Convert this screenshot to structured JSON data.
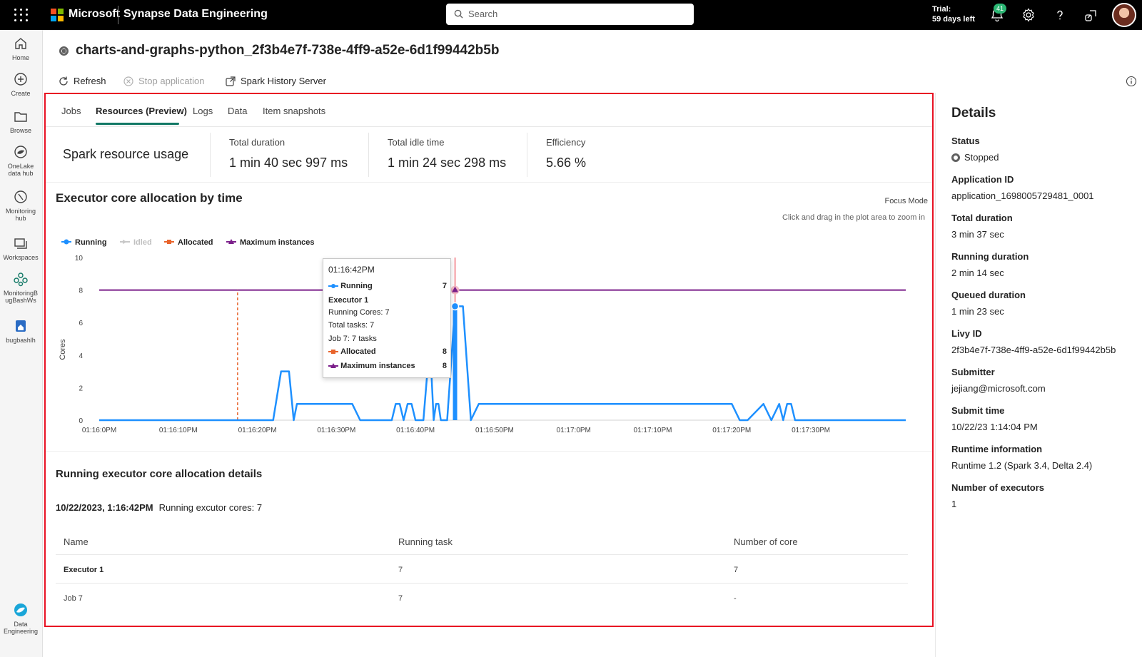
{
  "topbar": {
    "brand": "Microsoft",
    "app_name": "Synapse Data Engineering",
    "search_placeholder": "Search",
    "trial_line1": "Trial:",
    "trial_line2": "59 days left",
    "notification_count": "41"
  },
  "rail": {
    "items": [
      {
        "label": "Home",
        "icon": "home-icon"
      },
      {
        "label": "Create",
        "icon": "plus-circle-icon"
      },
      {
        "label": "Browse",
        "icon": "folder-icon"
      },
      {
        "label_line1": "OneLake",
        "label_line2": "data hub",
        "icon": "onelake-icon"
      },
      {
        "label_line1": "Monitoring",
        "label_line2": "hub",
        "icon": "monitor-icon"
      },
      {
        "label": "Workspaces",
        "icon": "workspaces-icon"
      },
      {
        "label_line1": "MonitoringB",
        "label_line2": "ugBashWs",
        "icon": "workspace-people-icon"
      },
      {
        "label": "bugbashlh",
        "icon": "lakehouse-icon"
      },
      {
        "label_line1": "Data",
        "label_line2": "Engineering",
        "icon": "data-engineering-icon"
      }
    ]
  },
  "header": {
    "title": "charts-and-graphs-python_2f3b4e7f-738e-4ff9-a52e-6d1f99442b5b",
    "refresh": "Refresh",
    "stop": "Stop application",
    "history": "Spark History Server"
  },
  "tabs": [
    "Jobs",
    "Resources (Preview)",
    "Logs",
    "Data",
    "Item snapshots"
  ],
  "usage": {
    "title": "Spark resource usage",
    "total_duration_label": "Total duration",
    "total_duration": "1 min 40 sec 997 ms",
    "idle_label": "Total idle time",
    "idle": "1 min 24 sec 298 ms",
    "efficiency_label": "Efficiency",
    "efficiency": "5.66 %"
  },
  "chart": {
    "title": "Executor core allocation by time",
    "focus_mode": "Focus Mode",
    "zoom_hint": "Click and drag in the plot area to zoom in"
  },
  "chart_data": {
    "type": "line",
    "ylabel": "Cores",
    "ylim": [
      0,
      10
    ],
    "yticks": [
      "0",
      "2",
      "4",
      "6",
      "8",
      "10"
    ],
    "xticks": [
      "01:16:0PM",
      "01:16:10PM",
      "01:16:20PM",
      "01:16:30PM",
      "01:16:40PM",
      "01:16:50PM",
      "01:17:0PM",
      "01:17:10PM",
      "01:17:20PM",
      "01:17:30PM"
    ],
    "legend": [
      "Running",
      "Idled",
      "Allocated",
      "Maximum instances"
    ],
    "colors": {
      "running": "#1e90ff",
      "idled": "#c8c8c8",
      "allocated": "#e8642c",
      "max": "#7b1f8a",
      "cursor": "#e81123"
    },
    "series": [
      {
        "name": "Running",
        "x": [
          0,
          22,
          23,
          24,
          24.6,
          25,
          25.6,
          32,
          33,
          37,
          37.5,
          38,
          38.5,
          39,
          39.5,
          40,
          40.5,
          41,
          41.5,
          42,
          42.3,
          42.6,
          42.9,
          43.2,
          43.6,
          44,
          45,
          46,
          47,
          48,
          80,
          81,
          82,
          84,
          85,
          86,
          86.5,
          87,
          87.5,
          88,
          102
        ],
        "y": [
          0,
          0,
          3,
          3,
          0,
          1,
          1,
          1,
          0,
          0,
          1,
          1,
          0,
          1,
          1,
          0,
          0,
          0,
          3,
          3,
          0,
          1,
          1,
          0,
          0,
          0,
          7,
          7,
          0,
          1,
          1,
          0,
          0,
          1,
          0,
          1,
          0,
          1,
          1,
          0,
          0
        ]
      },
      {
        "name": "Maximum instances",
        "x": [
          0,
          102
        ],
        "y": [
          8,
          8
        ]
      },
      {
        "name": "Allocated",
        "x": [
          17.5,
          17.5
        ],
        "y": [
          0,
          8
        ]
      }
    ]
  },
  "tooltip": {
    "time": "01:16:42PM",
    "running_label": "Running",
    "running_value": "7",
    "executor": "Executor 1",
    "running_cores": "Running Cores: 7",
    "total_tasks": "Total tasks: 7",
    "job": "Job 7: 7 tasks",
    "allocated_label": "Allocated",
    "allocated_value": "8",
    "max_label": "Maximum instances",
    "max_value": "8"
  },
  "details_section": {
    "title": "Running executor core allocation details",
    "timestamp": "10/22/2023, 1:16:42PM",
    "cores_text": "Running excutor cores: 7",
    "columns": [
      "Name",
      "Running task",
      "Number of core"
    ],
    "rows": [
      [
        "Executor 1",
        "7",
        "7"
      ],
      [
        "Job 7",
        "7",
        "-"
      ]
    ]
  },
  "details_pane": {
    "title": "Details",
    "fields": [
      {
        "label": "Status",
        "value": "Stopped"
      },
      {
        "label": "Application ID",
        "value": "application_1698005729481_0001"
      },
      {
        "label": "Total duration",
        "value": "3 min 37 sec"
      },
      {
        "label": "Running duration",
        "value": "2 min 14 sec"
      },
      {
        "label": "Queued duration",
        "value": "1 min 23 sec"
      },
      {
        "label": "Livy ID",
        "value": "2f3b4e7f-738e-4ff9-a52e-6d1f99442b5b"
      },
      {
        "label": "Submitter",
        "value": "jejiang@microsoft.com"
      },
      {
        "label": "Submit time",
        "value": "10/22/23 1:14:04 PM"
      },
      {
        "label": "Runtime information",
        "value": "Runtime 1.2 (Spark 3.4, Delta 2.4)"
      },
      {
        "label": "Number of executors",
        "value": "1"
      }
    ]
  }
}
